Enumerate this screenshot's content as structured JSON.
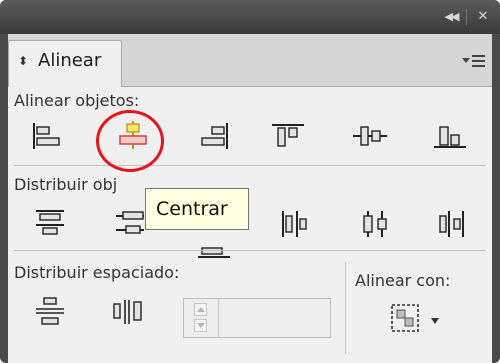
{
  "window": {
    "collapse_icon": "double-chevron-left-icon",
    "close_icon": "close-icon"
  },
  "panel": {
    "tab_label": "Alinear",
    "tab_icon": "updown-arrows-icon",
    "menu_icon": "panel-menu-icon"
  },
  "align_objects": {
    "title": "Alinear objetos:",
    "buttons": [
      {
        "icon": "align-left-edge-icon"
      },
      {
        "icon": "align-horizontal-center-icon",
        "highlighted": true
      },
      {
        "icon": "align-right-edge-icon"
      },
      {
        "icon": "align-top-edge-icon"
      },
      {
        "icon": "align-vertical-center-icon"
      },
      {
        "icon": "align-bottom-edge-icon"
      }
    ]
  },
  "distribute_objects": {
    "title": "Distribuir obj",
    "buttons": [
      {
        "icon": "distribute-top-edge-icon"
      },
      {
        "icon": "distribute-vertical-center-icon"
      },
      {
        "icon": "distribute-bottom-edge-icon"
      },
      {
        "icon": "distribute-left-edge-icon"
      },
      {
        "icon": "distribute-horizontal-center-icon"
      },
      {
        "icon": "distribute-right-edge-icon"
      }
    ]
  },
  "tooltip": {
    "text": "Centrar"
  },
  "distribute_spacing": {
    "title": "Distribuir espaciado:",
    "buttons": [
      {
        "icon": "distribute-vertical-space-icon"
      },
      {
        "icon": "distribute-horizontal-space-icon"
      }
    ],
    "spacing_value": ""
  },
  "align_to": {
    "title": "Alinear con:",
    "icon": "align-to-selection-icon"
  },
  "colors": {
    "panel_frame": "#4a4a4a",
    "panel_bg": "#f0f0f0",
    "tooltip_bg": "#ffffe1",
    "highlight_circle": "#e8141b",
    "icon_highlight_fill": "#f6c9c9",
    "icon_highlight_accent": "#e0a814"
  }
}
